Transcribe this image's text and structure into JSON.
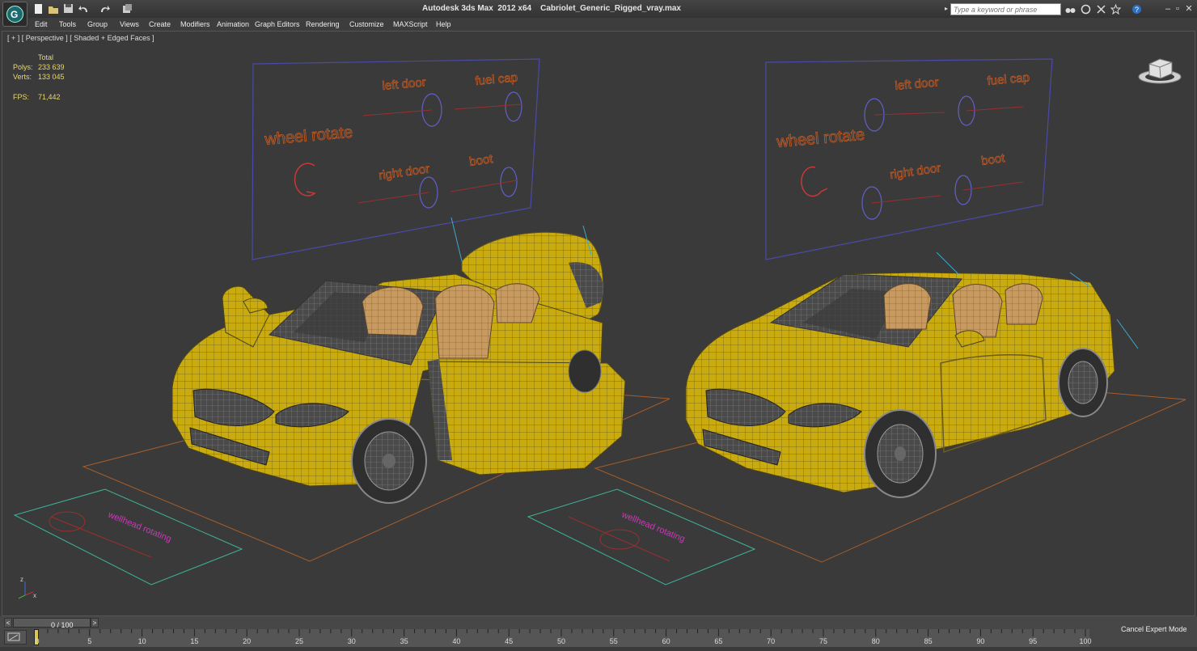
{
  "titlebar": {
    "title": "Autodesk 3ds Max  2012 x64    Cabriolet_Generic_Rigged_vray.max",
    "search_placeholder": "Type a keyword or phrase",
    "icons": [
      "new-file-icon",
      "open-file-icon",
      "save-icon",
      "undo-icon",
      "redo-icon",
      "project-folder-icon",
      "binoculars-icon",
      "subscription-icon",
      "communication-center-icon",
      "favorites-star-icon",
      "help-icon",
      "minimize-icon",
      "maximize-icon",
      "close-icon"
    ]
  },
  "menu": [
    "Edit",
    "Tools",
    "Group",
    "Views",
    "Create",
    "Modifiers",
    "Animation",
    "Graph Editors",
    "Rendering",
    "Customize",
    "MAXScript",
    "Help"
  ],
  "viewport": {
    "label": "[ + ] [ Perspective ] [ Shaded + Edged Faces ]",
    "stats": {
      "total_label": "Total",
      "polys_label": "Polys:",
      "polys_value": "233 639",
      "verts_label": "Verts:",
      "verts_value": "133 045",
      "fps_label": "FPS:",
      "fps_value": "71,442"
    },
    "left_panel": {
      "wheel": "wheel rotate",
      "left_door": "left door",
      "fuel_cap": "fuel cap",
      "right_door": "right door",
      "boot": "boot"
    },
    "right_panel": {
      "wheel": "wheel rotate",
      "left_door": "left door",
      "fuel_cap": "fuel cap",
      "right_door": "right door",
      "boot": "boot"
    },
    "ground_text": "wellhead rotating",
    "axis": {
      "z": "z",
      "x": "x"
    },
    "viewcube_label": "viewcube"
  },
  "timeline": {
    "slider_label": "0 / 100",
    "prev": "<",
    "next": ">",
    "ticks": [
      "0",
      "5",
      "10",
      "15",
      "20",
      "25",
      "30",
      "35",
      "40",
      "45",
      "50",
      "55",
      "60",
      "65",
      "70",
      "75",
      "80",
      "85",
      "90",
      "95",
      "100"
    ],
    "expert_button": "Cancel Expert Mode"
  },
  "colors": {
    "car_body": "#c9ab10",
    "panel_line": "#4a4aa8",
    "panel_text": "#c85a20",
    "ground_plane": "#3fb39a",
    "ground_label": "#c63bb4"
  }
}
